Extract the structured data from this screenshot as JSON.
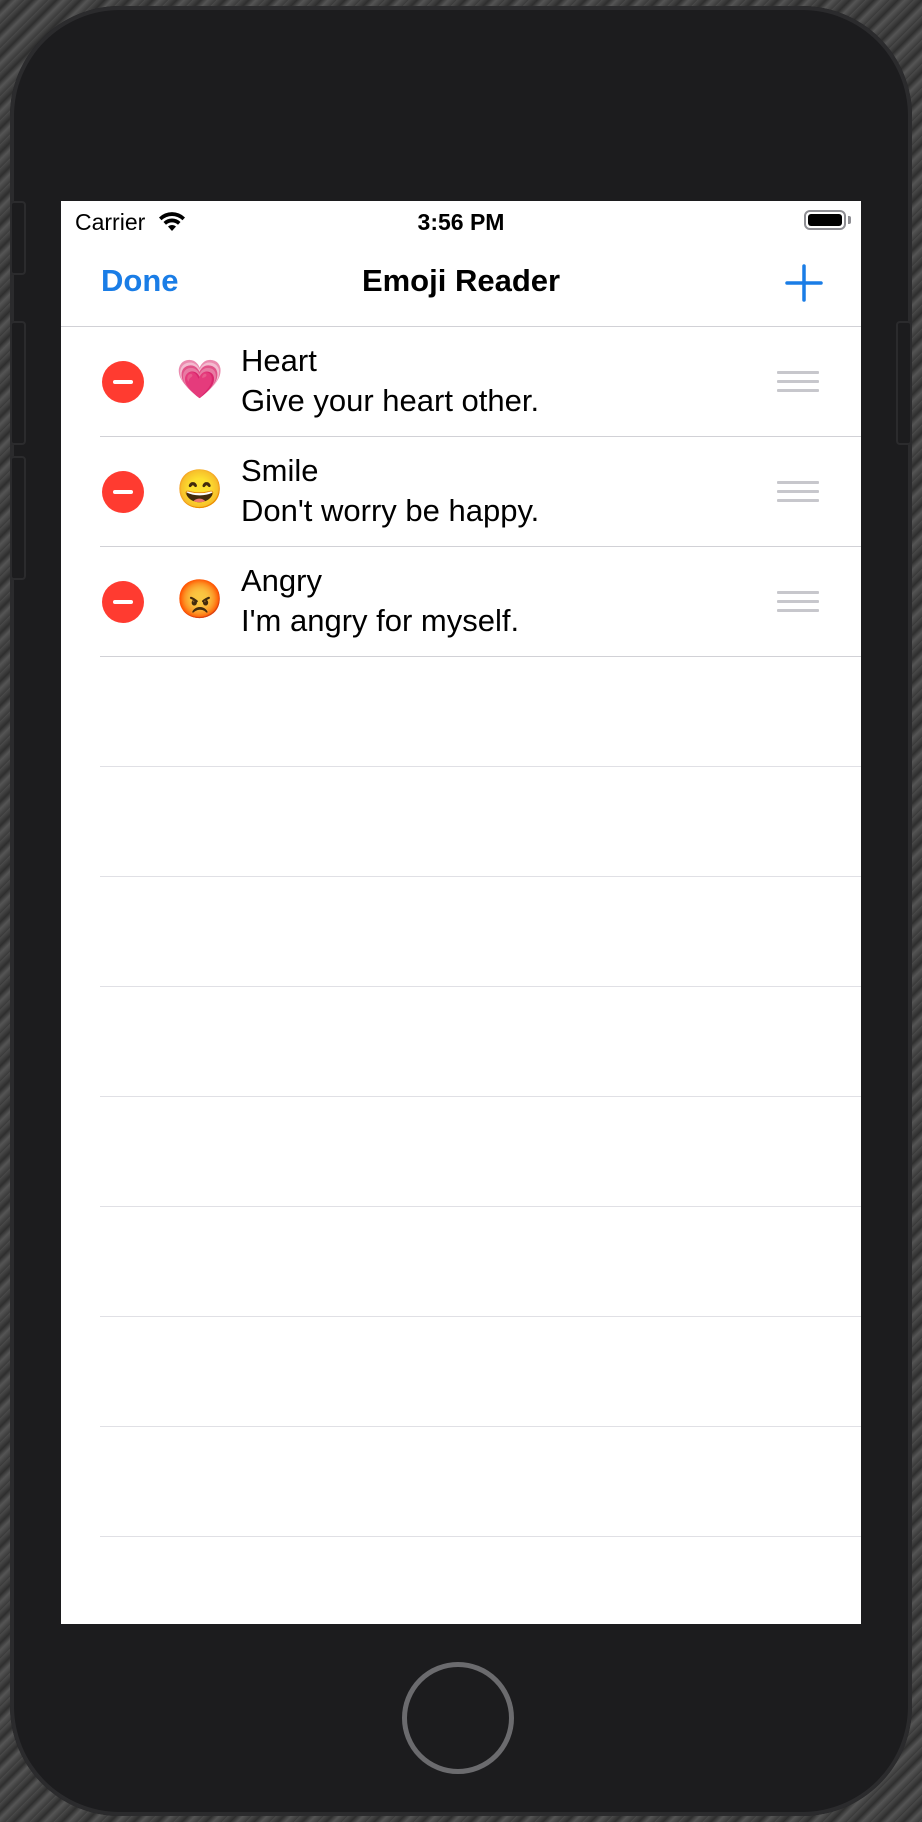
{
  "status_bar": {
    "carrier": "Carrier",
    "time": "3:56 PM",
    "battery_level": 1.0
  },
  "nav_bar": {
    "done_label": "Done",
    "title": "Emoji Reader",
    "add_icon": "plus-icon"
  },
  "rows": [
    {
      "emoji": "💗",
      "title": "Heart",
      "subtitle": "Give your heart other."
    },
    {
      "emoji": "😄",
      "title": "Smile",
      "subtitle": "Don't worry be happy."
    },
    {
      "emoji": "😡",
      "title": "Angry",
      "subtitle": "I'm angry for myself."
    }
  ],
  "colors": {
    "accent": "#1a7de6",
    "delete": "#ff3b30",
    "separator": "#d1d1d6"
  }
}
